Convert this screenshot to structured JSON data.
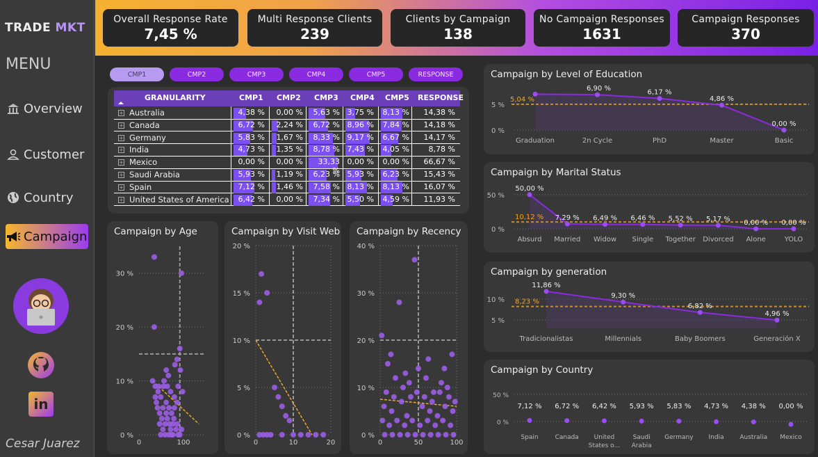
{
  "logo": {
    "part1": "TRADE",
    "part2": "MKT"
  },
  "menu": {
    "title": "MENU",
    "items": [
      {
        "label": "Overview",
        "icon": "bank-icon"
      },
      {
        "label": "Customer",
        "icon": "person-icon"
      },
      {
        "label": "Country",
        "icon": "globe-icon"
      },
      {
        "label": "Campaign",
        "icon": "megaphone-icon"
      }
    ]
  },
  "author": "Cesar Juarez",
  "kpis": [
    {
      "title": "Overall Response Rate",
      "value": "7,45 %"
    },
    {
      "title": "Multi Response Clients",
      "value": "239"
    },
    {
      "title": "Clients by Campaign",
      "value": "138"
    },
    {
      "title": "No Campaign Responses",
      "value": "1631"
    },
    {
      "title": "Campaign Responses",
      "value": "370"
    }
  ],
  "campaign_buttons": [
    "CMP1",
    "CMP2",
    "CMP3",
    "CMP4",
    "CMP5",
    "RESPONSE"
  ],
  "table": {
    "headers": [
      "GRANULARITY",
      "CMP1",
      "CMP2",
      "CMP3",
      "CMP4",
      "CMP5",
      "RESPONSE"
    ],
    "rows": [
      {
        "country": "Australia",
        "vals": [
          "4,38 %",
          "0,00 %",
          "5,63 %",
          "3,75 %",
          "8,13 %",
          "14,38 %"
        ],
        "nums": [
          4.38,
          0,
          5.63,
          3.75,
          8.13,
          14.38
        ]
      },
      {
        "country": "Canada",
        "vals": [
          "6,72 %",
          "2,24 %",
          "6,72 %",
          "8,96 %",
          "7,84 %",
          "14,18 %"
        ],
        "nums": [
          6.72,
          2.24,
          6.72,
          8.96,
          7.84,
          14.18
        ]
      },
      {
        "country": "Germany",
        "vals": [
          "5,83 %",
          "1,67 %",
          "8,33 %",
          "9,17 %",
          "6,67 %",
          "14,17 %"
        ],
        "nums": [
          5.83,
          1.67,
          8.33,
          9.17,
          6.67,
          14.17
        ]
      },
      {
        "country": "India",
        "vals": [
          "4,73 %",
          "1,35 %",
          "8,78 %",
          "7,43 %",
          "4,05 %",
          "8,78 %"
        ],
        "nums": [
          4.73,
          1.35,
          8.78,
          7.43,
          4.05,
          8.78
        ]
      },
      {
        "country": "Mexico",
        "vals": [
          "0,00 %",
          "0,00 %",
          "33,33 %",
          "0,00 %",
          "0,00 %",
          "66,67 %"
        ],
        "nums": [
          0,
          0,
          33.33,
          0,
          0,
          66.67
        ]
      },
      {
        "country": "Saudi Arabia",
        "vals": [
          "5,93 %",
          "1,19 %",
          "6,23 %",
          "5,93 %",
          "6,23 %",
          "15,43 %"
        ],
        "nums": [
          5.93,
          1.19,
          6.23,
          5.93,
          6.23,
          15.43
        ]
      },
      {
        "country": "Spain",
        "vals": [
          "7,12 %",
          "1,46 %",
          "7,58 %",
          "8,13 %",
          "8,13 %",
          "16,07 %"
        ],
        "nums": [
          7.12,
          1.46,
          7.58,
          8.13,
          8.13,
          16.07
        ]
      },
      {
        "country": "United States of America",
        "vals": [
          "6,42 %",
          "0,00 %",
          "7,34 %",
          "5,50 %",
          "4,59 %",
          "11,93 %"
        ],
        "nums": [
          6.42,
          0,
          7.34,
          5.5,
          4.59,
          11.93
        ]
      }
    ]
  },
  "colors": {
    "accent": "#8a2be2",
    "orange": "#f5a623",
    "bar": "#7b4ff0",
    "point": "#9b5de5"
  },
  "chart_data": [
    {
      "type": "line",
      "title": "Campaign by Level of Education",
      "categories": [
        "Graduation",
        "2n Cycle",
        "PhD",
        "Master",
        "Basic"
      ],
      "values": [
        7.0,
        6.9,
        6.17,
        4.86,
        0.0
      ],
      "labels": [
        "",
        "6,90 %",
        "6,17 %",
        "4,86 %",
        "0,00 %"
      ],
      "reference": {
        "value": 5.04,
        "label": "5,04 %"
      },
      "yticks": [
        "5 %",
        "0 %"
      ],
      "ylim": [
        0,
        8
      ]
    },
    {
      "type": "line",
      "title": "Campaign by Marital Status",
      "categories": [
        "Absurd",
        "Married",
        "Widow",
        "Single",
        "Together",
        "Divorced",
        "Alone",
        "YOLO"
      ],
      "values": [
        50.0,
        7.29,
        6.49,
        6.46,
        5.52,
        5.17,
        0.0,
        0.0
      ],
      "labels": [
        "50,00 %",
        "7,29 %",
        "6,49 %",
        "6,46 %",
        "5,52 %",
        "5,17 %",
        "0,00 %",
        "0,00 %"
      ],
      "reference": {
        "value": 10.12,
        "label": "10,12 %"
      },
      "yticks": [
        "50 %",
        "0 %"
      ],
      "ylim": [
        0,
        55
      ]
    },
    {
      "type": "line",
      "title": "Campaign by generation",
      "categories": [
        "Tradicionalistas",
        "Millennials",
        "Baby Boomers",
        "Generación X"
      ],
      "values": [
        11.86,
        9.3,
        6.82,
        4.96
      ],
      "labels": [
        "11,86 %",
        "9,30 %",
        "6,82 %",
        "4,96 %"
      ],
      "reference": {
        "value": 8.23,
        "label": "8,23 %"
      },
      "yticks": [
        "10 %",
        "5 %"
      ],
      "ylim": [
        3,
        13
      ]
    },
    {
      "type": "scatter",
      "title": "Campaign by Country",
      "categories": [
        "Spain",
        "Canada",
        "United States o...",
        "Saudi Arabia",
        "Germany",
        "India",
        "Australia",
        "Mexico"
      ],
      "values": [
        7.12,
        6.72,
        6.42,
        5.93,
        5.83,
        4.73,
        4.38,
        0.0
      ],
      "labels": [
        "7,12 %",
        "6,72 %",
        "6,42 %",
        "5,93 %",
        "5,83 %",
        "4,73 %",
        "4,38 %",
        "0,00 %"
      ],
      "yticks": [
        "50 %",
        "0 %"
      ]
    },
    {
      "type": "scatter",
      "title": "Campaign by Age",
      "xticks": [
        "0",
        "100"
      ],
      "yticks": [
        "30 %",
        "20 %",
        "10 %",
        "0 %"
      ],
      "xlim": [
        0,
        120
      ],
      "ylim": [
        0,
        35
      ],
      "points": [
        [
          28,
          33
        ],
        [
          28,
          20
        ],
        [
          78,
          30
        ],
        [
          70,
          14
        ],
        [
          75,
          16
        ],
        [
          30,
          9
        ],
        [
          35,
          8
        ],
        [
          40,
          7
        ],
        [
          45,
          9
        ],
        [
          50,
          6
        ],
        [
          55,
          5
        ],
        [
          60,
          4
        ],
        [
          65,
          5
        ],
        [
          32,
          6
        ],
        [
          38,
          4
        ],
        [
          42,
          3
        ],
        [
          48,
          2
        ],
        [
          52,
          3
        ],
        [
          58,
          1
        ],
        [
          62,
          2
        ],
        [
          68,
          1
        ],
        [
          72,
          0
        ],
        [
          75,
          0
        ],
        [
          25,
          10
        ],
        [
          30,
          7
        ],
        [
          36,
          9
        ],
        [
          44,
          5
        ],
        [
          50,
          4
        ],
        [
          56,
          2
        ],
        [
          64,
          3
        ],
        [
          70,
          2
        ],
        [
          78,
          1
        ],
        [
          48,
          0
        ],
        [
          55,
          0
        ],
        [
          40,
          0
        ],
        [
          60,
          0
        ],
        [
          80,
          8
        ],
        [
          76,
          12
        ],
        [
          72,
          9
        ],
        [
          66,
          13
        ],
        [
          65,
          7
        ],
        [
          58,
          8
        ],
        [
          52,
          9
        ],
        [
          46,
          10
        ],
        [
          34,
          5
        ],
        [
          38,
          2
        ],
        [
          44,
          1
        ],
        [
          62,
          0
        ],
        [
          70,
          6
        ],
        [
          50,
          12
        ],
        [
          54,
          11
        ]
      ]
    },
    {
      "type": "scatter",
      "title": "Campaign by Visit Web",
      "xticks": [
        "0",
        "10",
        "20"
      ],
      "yticks": [
        "20 %",
        "15 %",
        "10 %",
        "5 %",
        "0 %"
      ],
      "xlim": [
        0,
        20
      ],
      "ylim": [
        0,
        20
      ],
      "points": [
        [
          1,
          14
        ],
        [
          1.5,
          17
        ],
        [
          3,
          15
        ],
        [
          6,
          4
        ],
        [
          5,
          5
        ],
        [
          7,
          3
        ],
        [
          8,
          2
        ],
        [
          9,
          1.5
        ],
        [
          2,
          0
        ],
        [
          4,
          0
        ],
        [
          10,
          0
        ],
        [
          12,
          0
        ],
        [
          14,
          0
        ],
        [
          3,
          0
        ],
        [
          7,
          0
        ],
        [
          1,
          0
        ],
        [
          16,
          0
        ],
        [
          18,
          0
        ]
      ]
    },
    {
      "type": "scatter",
      "title": "Campaign by Recency",
      "xticks": [
        "0",
        "50",
        "100"
      ],
      "yticks": [
        "40 %",
        "30 %",
        "20 %",
        "10 %",
        "0 %"
      ],
      "xlim": [
        0,
        100
      ],
      "ylim": [
        0,
        40
      ],
      "points": [
        [
          2,
          21
        ],
        [
          45,
          37
        ],
        [
          25,
          28
        ],
        [
          10,
          15
        ],
        [
          20,
          12
        ],
        [
          30,
          10
        ],
        [
          40,
          8
        ],
        [
          50,
          14
        ],
        [
          60,
          12
        ],
        [
          70,
          9
        ],
        [
          80,
          11
        ],
        [
          90,
          8
        ],
        [
          5,
          6
        ],
        [
          15,
          5
        ],
        [
          35,
          4
        ],
        [
          55,
          6
        ],
        [
          65,
          5
        ],
        [
          75,
          4
        ],
        [
          85,
          6
        ],
        [
          95,
          5
        ],
        [
          3,
          3
        ],
        [
          12,
          2
        ],
        [
          22,
          3
        ],
        [
          32,
          2
        ],
        [
          42,
          3
        ],
        [
          52,
          2
        ],
        [
          62,
          3
        ],
        [
          72,
          2
        ],
        [
          82,
          3
        ],
        [
          92,
          2
        ],
        [
          8,
          9
        ],
        [
          18,
          8
        ],
        [
          28,
          7
        ],
        [
          38,
          11
        ],
        [
          48,
          9
        ],
        [
          58,
          8
        ],
        [
          68,
          7
        ],
        [
          78,
          9
        ],
        [
          88,
          10
        ],
        [
          98,
          7
        ],
        [
          6,
          0
        ],
        [
          16,
          0
        ],
        [
          26,
          0
        ],
        [
          36,
          0
        ],
        [
          46,
          0
        ],
        [
          56,
          0
        ],
        [
          66,
          0
        ],
        [
          76,
          0
        ],
        [
          86,
          0
        ],
        [
          96,
          0
        ],
        [
          14,
          17
        ],
        [
          33,
          13
        ],
        [
          63,
          16
        ],
        [
          84,
          14
        ],
        [
          94,
          17
        ]
      ]
    }
  ]
}
